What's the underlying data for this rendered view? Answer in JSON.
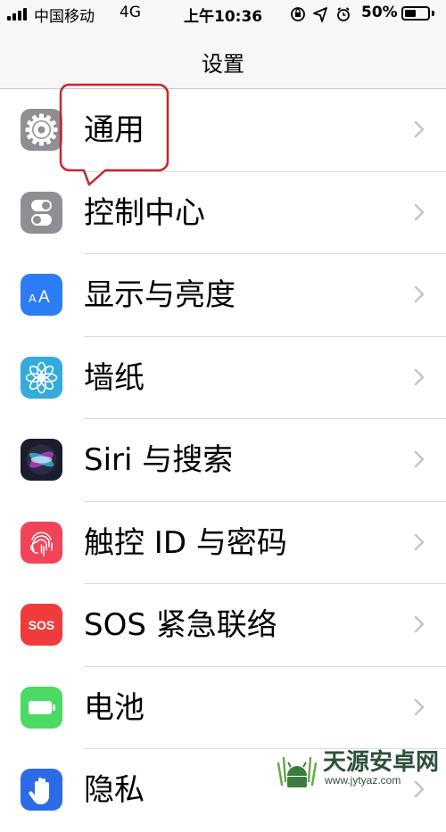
{
  "status_bar": {
    "carrier": "中国移动",
    "network": "4G",
    "time": "上午10:36",
    "battery_percent": "50%",
    "battery_level": 0.5,
    "status_icons": [
      "orientation-lock-icon",
      "location-icon",
      "alarm-icon"
    ]
  },
  "nav": {
    "title": "设置"
  },
  "settings": {
    "items": [
      {
        "label": "通用",
        "icon": "gear-icon",
        "color": "#8e8e93"
      },
      {
        "label": "控制中心",
        "icon": "toggle-switches-icon",
        "color": "#8e8e93"
      },
      {
        "label": "显示与亮度",
        "icon": "text-size-aa-icon",
        "color": "#2c7cf6"
      },
      {
        "label": "墙纸",
        "icon": "flower-icon",
        "color": "#35aadc"
      },
      {
        "label": "Siri 与搜索",
        "icon": "siri-icon",
        "color": "#1c1c2e"
      },
      {
        "label": "触控 ID 与密码",
        "icon": "fingerprint-icon",
        "color": "#f1445a"
      },
      {
        "label": "SOS 紧急联络",
        "icon": "sos-icon",
        "color": "#ef3b3b",
        "icon_text": "SOS"
      },
      {
        "label": "电池",
        "icon": "battery-icon",
        "color": "#4cd964"
      },
      {
        "label": "隐私",
        "icon": "hand-icon",
        "color": "#2c6be6"
      }
    ]
  },
  "annotation": {
    "highlighted_item": "通用",
    "color": "#c8242f"
  },
  "watermark": {
    "title": "天源安卓网",
    "url": "www.jytyaz.com"
  }
}
